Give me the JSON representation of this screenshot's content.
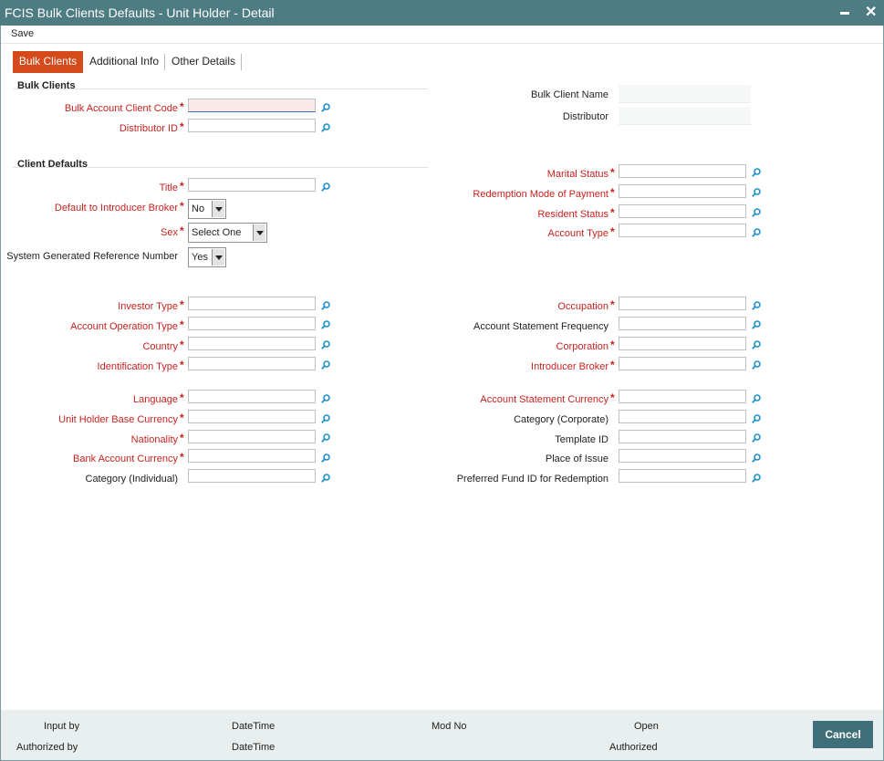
{
  "window": {
    "title": "FCIS Bulk Clients Defaults - Unit Holder - Detail",
    "minimize": "▬",
    "close": "✕"
  },
  "menu": {
    "save": "Save"
  },
  "tabs": [
    {
      "label": "Bulk Clients"
    },
    {
      "label": "Additional Info"
    },
    {
      "label": "Other Details"
    }
  ],
  "sections": {
    "bulk_clients": "Bulk Clients",
    "client_defaults": "Client Defaults"
  },
  "bulk": {
    "account_code": {
      "label": "Bulk Account Client Code",
      "value": ""
    },
    "distributor_id": {
      "label": "Distributor ID",
      "value": ""
    },
    "client_name": {
      "label": "Bulk Client Name",
      "value": ""
    },
    "distributor": {
      "label": "Distributor",
      "value": ""
    }
  },
  "defaults": {
    "title": {
      "label": "Title",
      "value": ""
    },
    "introducer": {
      "label": "Default to Introducer Broker",
      "value": "No"
    },
    "sex": {
      "label": "Sex",
      "value": "Select One"
    },
    "sysref": {
      "label": "System Generated Reference Number",
      "value": "Yes"
    },
    "marital": {
      "label": "Marital Status",
      "value": ""
    },
    "redemption": {
      "label": "Redemption Mode of Payment",
      "value": ""
    },
    "resident": {
      "label": "Resident Status",
      "value": ""
    },
    "account_type": {
      "label": "Account Type",
      "value": ""
    },
    "investor_type": {
      "label": "Investor Type",
      "value": ""
    },
    "acct_op_type": {
      "label": "Account Operation Type",
      "value": ""
    },
    "country": {
      "label": "Country",
      "value": ""
    },
    "id_type": {
      "label": "Identification Type",
      "value": ""
    },
    "occupation": {
      "label": "Occupation",
      "value": ""
    },
    "stmt_freq": {
      "label": "Account Statement Frequency",
      "value": ""
    },
    "corporation": {
      "label": "Corporation",
      "value": ""
    },
    "introducer_broker": {
      "label": "Introducer Broker",
      "value": ""
    },
    "language": {
      "label": "Language",
      "value": ""
    },
    "uh_base_ccy": {
      "label": "Unit Holder Base Currency",
      "value": ""
    },
    "nationality": {
      "label": "Nationality",
      "value": ""
    },
    "bank_ccy": {
      "label": "Bank Account Currency",
      "value": ""
    },
    "cat_individual": {
      "label": "Category (Individual)",
      "value": ""
    },
    "stmt_ccy": {
      "label": "Account Statement Currency",
      "value": ""
    },
    "cat_corporate": {
      "label": "Category (Corporate)",
      "value": ""
    },
    "template_id": {
      "label": "Template ID",
      "value": ""
    },
    "place_issue": {
      "label": "Place of Issue",
      "value": ""
    },
    "pref_fund": {
      "label": "Preferred Fund ID for Redemption",
      "value": ""
    }
  },
  "required_mark": "*",
  "footer": {
    "input_by": "Input by",
    "date_time_1": "DateTime",
    "mod_no": "Mod No",
    "open": "Open",
    "authorized_by": "Authorized by",
    "date_time_2": "DateTime",
    "authorized": "Authorized",
    "cancel": "Cancel"
  },
  "colors": {
    "titlebar": "#4e7c83",
    "active_tab": "#d44a1b",
    "required": "#c8221e",
    "cancel": "#3f6f78",
    "lookup_icon": "#1f8fc7"
  }
}
